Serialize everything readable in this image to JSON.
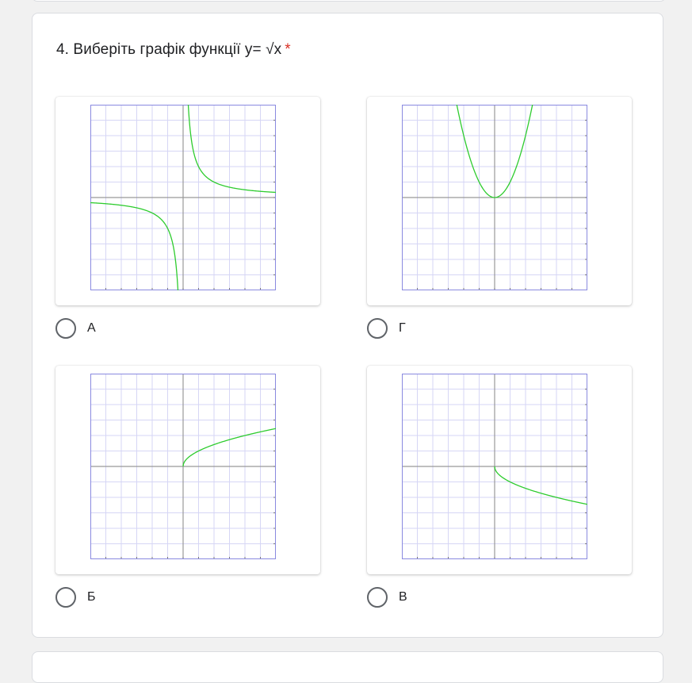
{
  "question": {
    "number_text": "4. Виберіть графік функції у= √х",
    "required_mark": "*"
  },
  "options": [
    {
      "label": "А",
      "graph": "hyperbola"
    },
    {
      "label": "Г",
      "graph": "parabola"
    },
    {
      "label": "Б",
      "graph": "sqrt"
    },
    {
      "label": "В",
      "graph": "neg_sqrt"
    }
  ],
  "colors": {
    "curve": "#2ecc2e",
    "grid": "#d6d6f5",
    "axis": "#999999",
    "frame": "#8a8ae0",
    "required": "#d93025"
  }
}
